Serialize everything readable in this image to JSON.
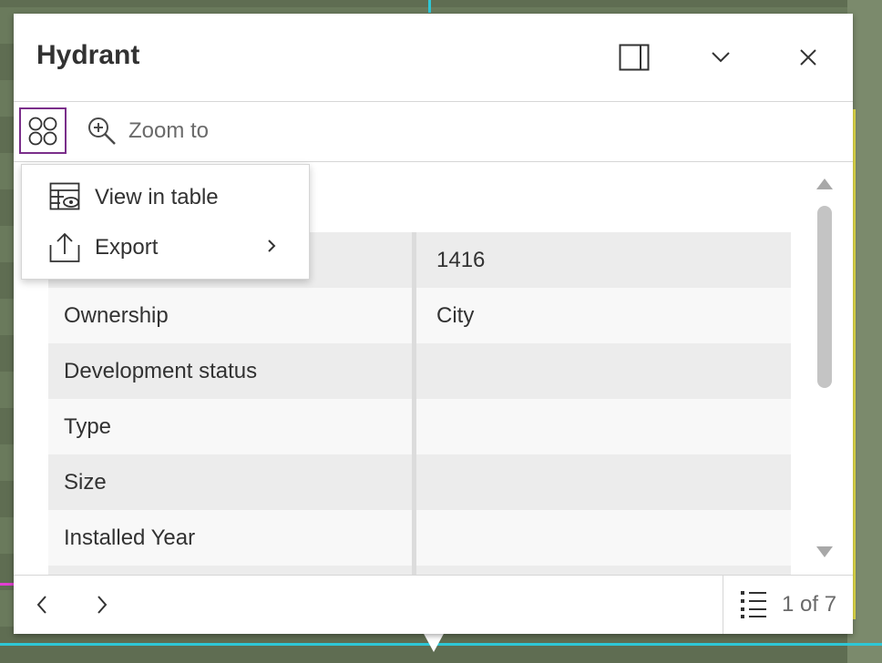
{
  "popup": {
    "title": "Hydrant",
    "header_buttons": {
      "dock_icon": "dock-side-icon",
      "collapse_icon": "chevron-down-icon",
      "close_icon": "close-icon"
    },
    "toolbar": {
      "actions_icon": "actions-grid-icon",
      "zoom_label": "Zoom to",
      "zoom_icon": "zoom-in-icon"
    },
    "attributes": [
      {
        "name": "",
        "value": "1416"
      },
      {
        "name": "Ownership",
        "value": "City"
      },
      {
        "name": "Development status",
        "value": ""
      },
      {
        "name": "Type",
        "value": ""
      },
      {
        "name": "Size",
        "value": ""
      },
      {
        "name": "Installed Year",
        "value": ""
      }
    ],
    "footer": {
      "prev_icon": "chevron-left-icon",
      "next_icon": "chevron-right-icon",
      "pager_icon": "list-icon",
      "pager_label": "1 of 7"
    }
  },
  "menu": {
    "items": [
      {
        "label": "View in table",
        "icon": "table-view-icon"
      },
      {
        "label": "Export",
        "icon": "export-icon"
      }
    ]
  },
  "colors": {
    "accent": "#7a2e8a",
    "text": "#323232",
    "muted": "#6a6a6a"
  }
}
